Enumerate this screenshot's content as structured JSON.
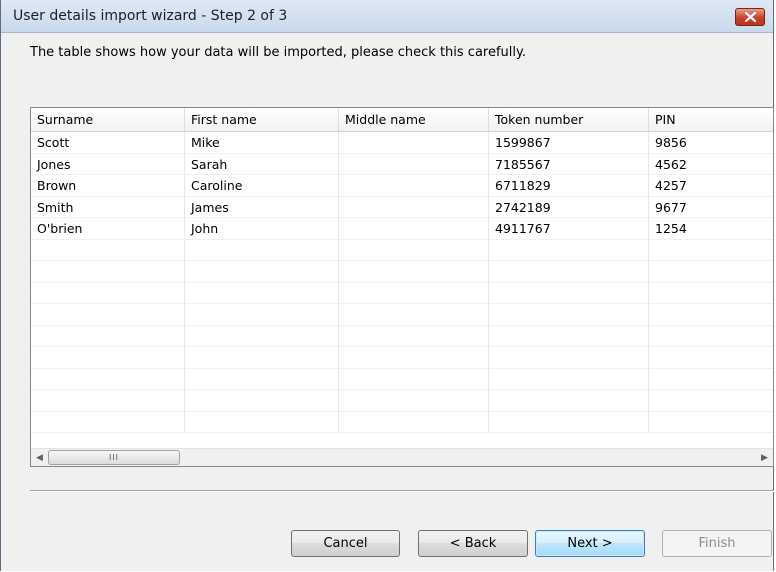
{
  "window": {
    "title": "User details import wizard - Step 2 of 3",
    "close_symbol": "✕"
  },
  "instructions": "The table shows how your data will be imported, please check this carefully.",
  "table": {
    "columns": [
      "Surname",
      "First name",
      "Middle name",
      "Token number",
      "PIN"
    ],
    "rows": [
      [
        "Scott",
        "Mike",
        "",
        "1599867",
        "9856"
      ],
      [
        "Jones",
        "Sarah",
        "",
        "7185567",
        "4562"
      ],
      [
        "Brown",
        "Caroline",
        "",
        "6711829",
        "4257"
      ],
      [
        "Smith",
        "James",
        "",
        "2742189",
        "9677"
      ],
      [
        "O'brien",
        "John",
        "",
        "4911767",
        "1254"
      ],
      [
        "",
        "",
        "",
        "",
        ""
      ],
      [
        "",
        "",
        "",
        "",
        ""
      ],
      [
        "",
        "",
        "",
        "",
        ""
      ],
      [
        "",
        "",
        "",
        "",
        ""
      ],
      [
        "",
        "",
        "",
        "",
        ""
      ],
      [
        "",
        "",
        "",
        "",
        ""
      ],
      [
        "",
        "",
        "",
        "",
        ""
      ],
      [
        "",
        "",
        "",
        "",
        ""
      ],
      [
        "",
        "",
        "",
        "",
        ""
      ]
    ]
  },
  "scrollbar": {
    "left_arrow": "◀",
    "right_arrow": "▶",
    "grip": "III"
  },
  "buttons": {
    "cancel": "Cancel",
    "back": "< Back",
    "next": "Next >",
    "finish": "Finish"
  },
  "icons": {
    "close": "close-icon",
    "scroll_left": "arrow-left-icon",
    "scroll_right": "arrow-right-icon"
  },
  "colors": {
    "close_button": "#c7402a",
    "default_button_border": "#3c7fb1"
  }
}
